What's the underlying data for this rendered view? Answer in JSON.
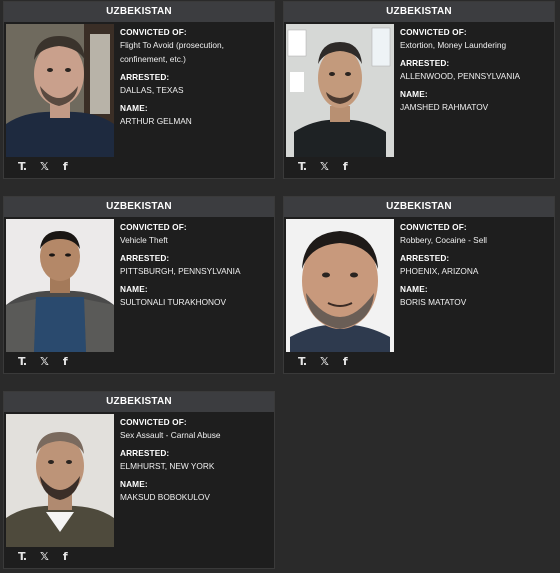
{
  "cards": [
    {
      "header": "UZBEKISTAN",
      "convicted_label": "CONVICTED OF:",
      "convicted": "Flight To Avoid (prosecution, confinement, etc.)",
      "arrested_label": "ARRESTED:",
      "arrested": "DALLAS, TEXAS",
      "name_label": "NAME:",
      "name": "ARTHUR GELMAN"
    },
    {
      "header": "UZBEKISTAN",
      "convicted_label": "CONVICTED OF:",
      "convicted": "Extortion, Money Laundering",
      "arrested_label": "ARRESTED:",
      "arrested": "ALLENWOOD, PENNSYLVANIA",
      "name_label": "NAME:",
      "name": "JAMSHED RAHMATOV"
    },
    {
      "header": "UZBEKISTAN",
      "convicted_label": "CONVICTED OF:",
      "convicted": "Vehicle Theft",
      "arrested_label": "ARRESTED:",
      "arrested": "PITTSBURGH, PENNSYLVANIA",
      "name_label": "NAME:",
      "name": "SULTONALI TURAKHONOV"
    },
    {
      "header": "UZBEKISTAN",
      "convicted_label": "CONVICTED OF:",
      "convicted": "Robbery, Cocaine - Sell",
      "arrested_label": "ARRESTED:",
      "arrested": "PHOENIX, ARIZONA",
      "name_label": "NAME:",
      "name": "BORIS MATATOV"
    },
    {
      "header": "UZBEKISTAN",
      "convicted_label": "CONVICTED OF:",
      "convicted": "Sex Assault - Carnal Abuse",
      "arrested_label": "ARRESTED:",
      "arrested": "ELMHURST, NEW YORK",
      "name_label": "NAME:",
      "name": "MAKSUD BOBOKULOV"
    }
  ],
  "social": {
    "truth_icon": "truth-social-icon",
    "x_icon": "x-icon",
    "facebook_icon": "facebook-icon",
    "truth_glyph": "T.",
    "x_glyph": "𝕏",
    "facebook_glyph": "f"
  },
  "colors": {
    "background": "#2a2a2a",
    "card": "#1e1e1e",
    "header": "#3c3d40"
  }
}
